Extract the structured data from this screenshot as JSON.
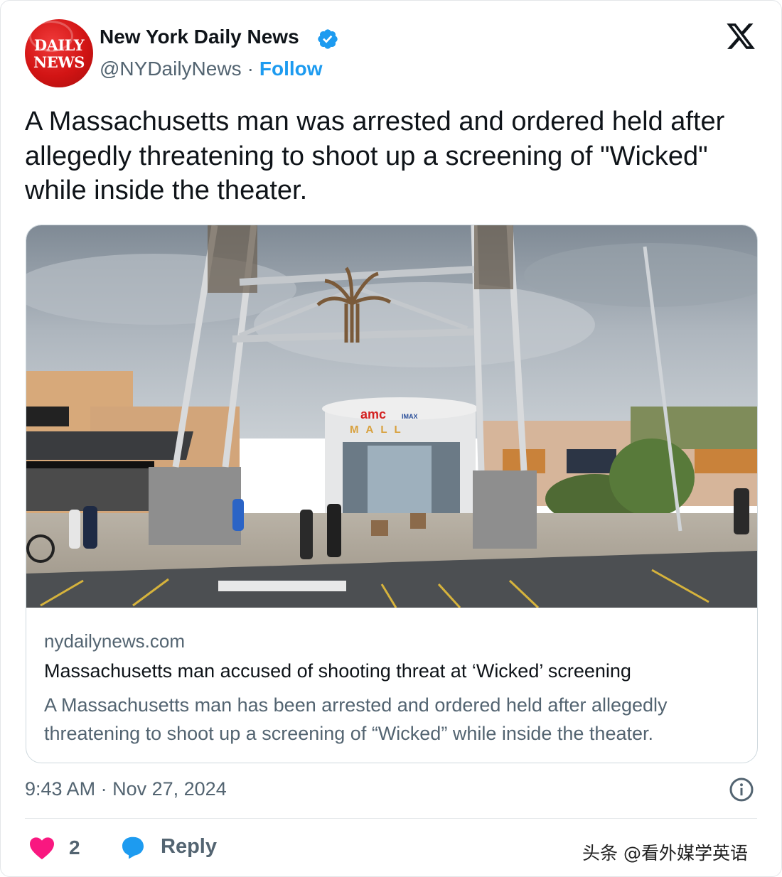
{
  "account": {
    "logo_line1": "DAILY",
    "logo_line2": "NEWS",
    "name": "New York Daily News",
    "verified_icon": "verified-badge-icon",
    "handle": "@NYDailyNews",
    "separator": "·",
    "follow_label": "Follow"
  },
  "platform_icon": "x-logo-icon",
  "tweet": {
    "text": "A Massachusetts man was arrested and ordered held after allegedly threatening to shoot up a screening of \"Wicked\" while inside the theater."
  },
  "link_card": {
    "image_sign_brand": "amc",
    "image_sign_mall": "MALL",
    "image_sign_imax": "IMAX",
    "domain": "nydailynews.com",
    "title": "Massachusetts man accused of shooting threat at ‘Wicked’ screening",
    "description": "A Massachusetts man has been arrested and ordered held after allegedly threatening to shoot up a screening of “Wicked” while inside the theater."
  },
  "meta": {
    "time": "9:43 AM",
    "separator": "·",
    "date": "Nov 27, 2024",
    "info_icon": "info-icon"
  },
  "actions": {
    "like_icon": "heart-icon",
    "like_count": "2",
    "reply_icon": "reply-icon",
    "reply_label": "Reply"
  },
  "watermark": "头条 @看外媒学英语",
  "colors": {
    "accent": "#1d9bf0",
    "like": "#f91880",
    "secondary_text": "#536471",
    "logo_red": "#d21414"
  }
}
